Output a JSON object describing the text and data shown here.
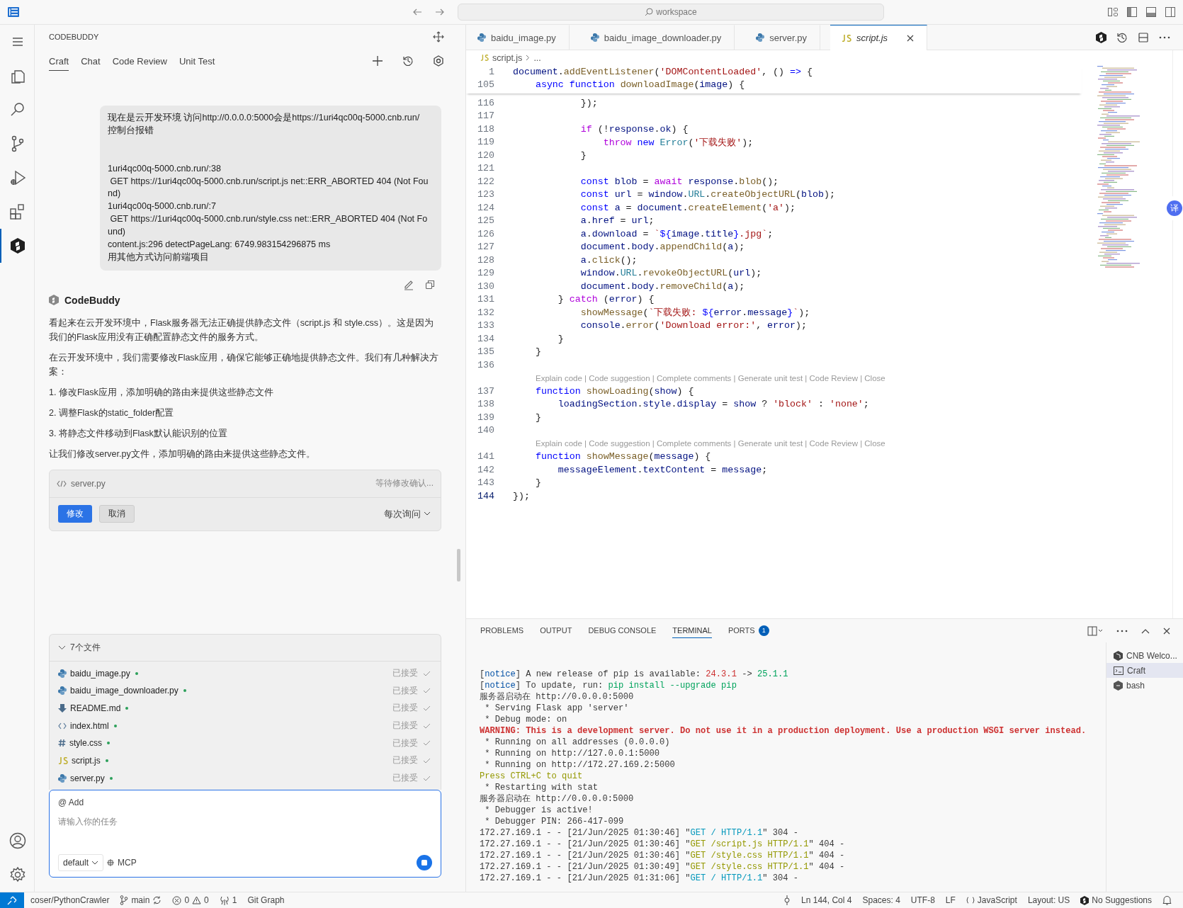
{
  "title_bar": {
    "search": "workspace"
  },
  "activity_bar": {
    "items": [
      {
        "selected": false
      },
      {
        "selected": false
      },
      {
        "selected": false
      },
      {
        "selected": false
      },
      {
        "selected": false
      },
      {
        "selected": true
      }
    ]
  },
  "chat_panel": {
    "title": "CODEBUDDY",
    "tabs": [
      {
        "label": "Craft",
        "selected": true
      },
      {
        "label": "Chat",
        "selected": false
      },
      {
        "label": "Code Review",
        "selected": false
      },
      {
        "label": "Unit Test",
        "selected": false
      }
    ],
    "user_message": [
      [
        "现在是云开发环境 访问http://0.0.0.0:5000会是https://1uri4qc00q-5000.cnb.run/",
        "控制台报错"
      ],
      [
        "1uri4qc00q-5000.cnb.run/:38",
        " GET https://1uri4qc00q-5000.cnb.run/script.js net::ERR_ABORTED 404 (Not Fou",
        "nd)",
        "1uri4qc00q-5000.cnb.run/:7",
        " GET https://1uri4qc00q-5000.cnb.run/style.css net::ERR_ABORTED 404 (Not Fo",
        "und)",
        "content.js:296 detectPageLang: 6749.983154296875 ms",
        "用其他方式访问前端项目"
      ]
    ],
    "assistant": {
      "name": "CodeBuddy",
      "paragraphs": [
        "看起来在云开发环境中，Flask服务器无法正确提供静态文件（script.js 和 style.css）。这是因为我们的Flask应用没有正确配置静态文件的服务方式。",
        "在云开发环境中，我们需要修改Flask应用，确保它能够正确地提供静态文件。我们有几种解决方案：",
        "1. 修改Flask应用，添加明确的路由来提供这些静态文件",
        "2. 调整Flask的static_folder配置",
        "3. 将静态文件移动到Flask默认能识别的位置",
        "让我们修改server.py文件，添加明确的路由来提供这些静态文件。"
      ]
    },
    "file_change": {
      "file": "server.py",
      "status": "等待修改确认...",
      "confirm": "修改",
      "cancel": "取消",
      "mode": "每次询问"
    },
    "files": {
      "summary": "7个文件",
      "expanded": true,
      "items": [
        {
          "name": "baidu_image.py",
          "kind": "python",
          "modified": true,
          "status": "已接受"
        },
        {
          "name": "baidu_image_downloader.py",
          "kind": "python",
          "modified": true,
          "status": "已接受"
        },
        {
          "name": "README.md",
          "kind": "markdown",
          "modified": true,
          "status": "已接受"
        },
        {
          "name": "index.html",
          "kind": "html",
          "modified": true,
          "status": "已接受"
        },
        {
          "name": "style.css",
          "kind": "css",
          "modified": true,
          "status": "已接受"
        },
        {
          "name": "script.js",
          "kind": "js",
          "modified": true,
          "status": "已接受"
        },
        {
          "name": "server.py",
          "kind": "python",
          "modified": true,
          "status": "已接受"
        }
      ]
    },
    "input": {
      "add": "@ Add",
      "placeholder": "请输入你的任务",
      "model": "default",
      "mcp": "MCP"
    }
  },
  "editor": {
    "tabs": [
      {
        "label": "baidu_image.py",
        "kind": "python",
        "selected": false,
        "preview": false
      },
      {
        "label": "baidu_image_downloader.py",
        "kind": "python",
        "selected": false,
        "preview": false
      },
      {
        "label": "server.py",
        "kind": "python",
        "selected": false,
        "preview": false
      },
      {
        "label": "script.js",
        "kind": "js",
        "selected": true,
        "preview": true
      }
    ],
    "breadcrumb": {
      "file": "script.js",
      "rest": "..."
    },
    "sticky": [
      {
        "n": "1",
        "tokens": [
          {
            "kind": "var",
            "text": "document"
          },
          {
            "kind": "plain",
            "text": "."
          },
          {
            "kind": "fn",
            "text": "addEventListener"
          },
          {
            "kind": "plain",
            "text": "("
          },
          {
            "kind": "str",
            "text": "'DOMContentLoaded'"
          },
          {
            "kind": "plain",
            "text": ", () "
          },
          {
            "kind": "kw",
            "text": "=>"
          },
          {
            "kind": "plain",
            "text": " {"
          }
        ]
      },
      {
        "n": "105",
        "tokens": [
          {
            "kind": "kw",
            "text": "    async"
          },
          {
            "kind": "kw",
            "text": " function"
          },
          {
            "kind": "fn",
            "text": " downloadImage"
          },
          {
            "kind": "plain",
            "text": "("
          },
          {
            "kind": "var",
            "text": "image"
          },
          {
            "kind": "plain",
            "text": ") {"
          }
        ]
      }
    ],
    "lines": [
      {
        "kind": "code",
        "n": "116",
        "tokens": [
          {
            "kind": "plain",
            "text": "            });"
          }
        ]
      },
      {
        "kind": "code",
        "n": "117"
      },
      {
        "kind": "code",
        "n": "118",
        "tokens": [
          {
            "kind": "ctl",
            "text": "            if"
          },
          {
            "kind": "plain",
            "text": " (!"
          },
          {
            "kind": "var",
            "text": "response"
          },
          {
            "kind": "plain",
            "text": "."
          },
          {
            "kind": "var",
            "text": "ok"
          },
          {
            "kind": "plain",
            "text": ") {"
          }
        ]
      },
      {
        "kind": "code",
        "n": "119",
        "tokens": [
          {
            "kind": "ctl",
            "text": "                throw"
          },
          {
            "kind": "kw",
            "text": " new"
          },
          {
            "kind": "type",
            "text": " Error"
          },
          {
            "kind": "plain",
            "text": "("
          },
          {
            "kind": "str",
            "text": "'下载失败'"
          },
          {
            "kind": "plain",
            "text": ");"
          }
        ]
      },
      {
        "kind": "code",
        "n": "120",
        "tokens": [
          {
            "kind": "plain",
            "text": "            }"
          }
        ]
      },
      {
        "kind": "code",
        "n": "121"
      },
      {
        "kind": "code",
        "n": "122",
        "tokens": [
          {
            "kind": "kw",
            "text": "            const"
          },
          {
            "kind": "var",
            "text": " blob"
          },
          {
            "kind": "plain",
            "text": " = "
          },
          {
            "kind": "ctl",
            "text": "await"
          },
          {
            "kind": "var",
            "text": " response"
          },
          {
            "kind": "plain",
            "text": "."
          },
          {
            "kind": "fn",
            "text": "blob"
          },
          {
            "kind": "plain",
            "text": "();"
          }
        ]
      },
      {
        "kind": "code",
        "n": "123",
        "tokens": [
          {
            "kind": "kw",
            "text": "            const"
          },
          {
            "kind": "var",
            "text": " url"
          },
          {
            "kind": "plain",
            "text": " = "
          },
          {
            "kind": "var",
            "text": "window"
          },
          {
            "kind": "plain",
            "text": "."
          },
          {
            "kind": "type",
            "text": "URL"
          },
          {
            "kind": "plain",
            "text": "."
          },
          {
            "kind": "fn",
            "text": "createObjectURL"
          },
          {
            "kind": "plain",
            "text": "("
          },
          {
            "kind": "var",
            "text": "blob"
          },
          {
            "kind": "plain",
            "text": ");"
          }
        ]
      },
      {
        "kind": "code",
        "n": "124",
        "tokens": [
          {
            "kind": "kw",
            "text": "            const"
          },
          {
            "kind": "var",
            "text": " a"
          },
          {
            "kind": "plain",
            "text": " = "
          },
          {
            "kind": "var",
            "text": "document"
          },
          {
            "kind": "plain",
            "text": "."
          },
          {
            "kind": "fn",
            "text": "createElement"
          },
          {
            "kind": "plain",
            "text": "("
          },
          {
            "kind": "str",
            "text": "'a'"
          },
          {
            "kind": "plain",
            "text": ");"
          }
        ]
      },
      {
        "kind": "code",
        "n": "125",
        "tokens": [
          {
            "kind": "var",
            "text": "            a"
          },
          {
            "kind": "plain",
            "text": "."
          },
          {
            "kind": "var",
            "text": "href"
          },
          {
            "kind": "plain",
            "text": " = "
          },
          {
            "kind": "var",
            "text": "url"
          },
          {
            "kind": "plain",
            "text": ";"
          }
        ]
      },
      {
        "kind": "code",
        "n": "126",
        "tokens": [
          {
            "kind": "var",
            "text": "            a"
          },
          {
            "kind": "plain",
            "text": "."
          },
          {
            "kind": "var",
            "text": "download"
          },
          {
            "kind": "plain",
            "text": " = "
          },
          {
            "kind": "str",
            "text": "`"
          },
          {
            "kind": "kw",
            "text": "${"
          },
          {
            "kind": "var",
            "text": "image"
          },
          {
            "kind": "plain",
            "text": "."
          },
          {
            "kind": "var",
            "text": "title"
          },
          {
            "kind": "kw",
            "text": "}"
          },
          {
            "kind": "str",
            "text": ".jpg`"
          },
          {
            "kind": "plain",
            "text": ";"
          }
        ]
      },
      {
        "kind": "code",
        "n": "127",
        "tokens": [
          {
            "kind": "var",
            "text": "            document"
          },
          {
            "kind": "plain",
            "text": "."
          },
          {
            "kind": "var",
            "text": "body"
          },
          {
            "kind": "plain",
            "text": "."
          },
          {
            "kind": "fn",
            "text": "appendChild"
          },
          {
            "kind": "plain",
            "text": "("
          },
          {
            "kind": "var",
            "text": "a"
          },
          {
            "kind": "plain",
            "text": ");"
          }
        ]
      },
      {
        "kind": "code",
        "n": "128",
        "tokens": [
          {
            "kind": "var",
            "text": "            a"
          },
          {
            "kind": "plain",
            "text": "."
          },
          {
            "kind": "fn",
            "text": "click"
          },
          {
            "kind": "plain",
            "text": "();"
          }
        ]
      },
      {
        "kind": "code",
        "n": "129",
        "tokens": [
          {
            "kind": "var",
            "text": "            window"
          },
          {
            "kind": "plain",
            "text": "."
          },
          {
            "kind": "type",
            "text": "URL"
          },
          {
            "kind": "plain",
            "text": "."
          },
          {
            "kind": "fn",
            "text": "revokeObjectURL"
          },
          {
            "kind": "plain",
            "text": "("
          },
          {
            "kind": "var",
            "text": "url"
          },
          {
            "kind": "plain",
            "text": ");"
          }
        ]
      },
      {
        "kind": "code",
        "n": "130",
        "tokens": [
          {
            "kind": "var",
            "text": "            document"
          },
          {
            "kind": "plain",
            "text": "."
          },
          {
            "kind": "var",
            "text": "body"
          },
          {
            "kind": "plain",
            "text": "."
          },
          {
            "kind": "fn",
            "text": "removeChild"
          },
          {
            "kind": "plain",
            "text": "("
          },
          {
            "kind": "var",
            "text": "a"
          },
          {
            "kind": "plain",
            "text": ");"
          }
        ]
      },
      {
        "kind": "code",
        "n": "131",
        "tokens": [
          {
            "kind": "plain",
            "text": "        } "
          },
          {
            "kind": "ctl",
            "text": "catch"
          },
          {
            "kind": "plain",
            "text": " ("
          },
          {
            "kind": "var",
            "text": "error"
          },
          {
            "kind": "plain",
            "text": ") {"
          }
        ]
      },
      {
        "kind": "code",
        "n": "132",
        "tokens": [
          {
            "kind": "fn",
            "text": "            showMessage"
          },
          {
            "kind": "plain",
            "text": "("
          },
          {
            "kind": "str",
            "text": "`下载失败: "
          },
          {
            "kind": "kw",
            "text": "${"
          },
          {
            "kind": "var",
            "text": "error"
          },
          {
            "kind": "plain",
            "text": "."
          },
          {
            "kind": "var",
            "text": "message"
          },
          {
            "kind": "kw",
            "text": "}"
          },
          {
            "kind": "str",
            "text": "`"
          },
          {
            "kind": "plain",
            "text": ");"
          }
        ]
      },
      {
        "kind": "code",
        "n": "133",
        "tokens": [
          {
            "kind": "var",
            "text": "            console"
          },
          {
            "kind": "plain",
            "text": "."
          },
          {
            "kind": "fn",
            "text": "error"
          },
          {
            "kind": "plain",
            "text": "("
          },
          {
            "kind": "str",
            "text": "'Download error:'"
          },
          {
            "kind": "plain",
            "text": ", "
          },
          {
            "kind": "var",
            "text": "error"
          },
          {
            "kind": "plain",
            "text": ");"
          }
        ]
      },
      {
        "kind": "code",
        "n": "134",
        "tokens": [
          {
            "kind": "plain",
            "text": "        }"
          }
        ]
      },
      {
        "kind": "code",
        "n": "135",
        "tokens": [
          {
            "kind": "plain",
            "text": "    }"
          }
        ]
      },
      {
        "kind": "code",
        "n": "136"
      },
      {
        "kind": "lens",
        "text": "Explain code | Code suggestion | Complete comments | Generate unit test | Code Review | Close"
      },
      {
        "kind": "code",
        "n": "137",
        "tokens": [
          {
            "kind": "kw",
            "text": "    function"
          },
          {
            "kind": "fn",
            "text": " showLoading"
          },
          {
            "kind": "plain",
            "text": "("
          },
          {
            "kind": "var",
            "text": "show"
          },
          {
            "kind": "plain",
            "text": ") {"
          }
        ]
      },
      {
        "kind": "code",
        "n": "138",
        "tokens": [
          {
            "kind": "var",
            "text": "        loadingSection"
          },
          {
            "kind": "plain",
            "text": "."
          },
          {
            "kind": "var",
            "text": "style"
          },
          {
            "kind": "plain",
            "text": "."
          },
          {
            "kind": "var",
            "text": "display"
          },
          {
            "kind": "plain",
            "text": " = "
          },
          {
            "kind": "var",
            "text": "show"
          },
          {
            "kind": "plain",
            "text": " ? "
          },
          {
            "kind": "str",
            "text": "'block'"
          },
          {
            "kind": "plain",
            "text": " : "
          },
          {
            "kind": "str",
            "text": "'none'"
          },
          {
            "kind": "plain",
            "text": ";"
          }
        ]
      },
      {
        "kind": "code",
        "n": "139",
        "tokens": [
          {
            "kind": "plain",
            "text": "    }"
          }
        ]
      },
      {
        "kind": "code",
        "n": "140"
      },
      {
        "kind": "lens",
        "text": "Explain code | Code suggestion | Complete comments | Generate unit test | Code Review | Close"
      },
      {
        "kind": "code",
        "n": "141",
        "tokens": [
          {
            "kind": "kw",
            "text": "    function"
          },
          {
            "kind": "fn",
            "text": " showMessage"
          },
          {
            "kind": "plain",
            "text": "("
          },
          {
            "kind": "var",
            "text": "message"
          },
          {
            "kind": "plain",
            "text": ") {"
          }
        ]
      },
      {
        "kind": "code",
        "n": "142",
        "tokens": [
          {
            "kind": "var",
            "text": "        messageElement"
          },
          {
            "kind": "plain",
            "text": "."
          },
          {
            "kind": "var",
            "text": "textContent"
          },
          {
            "kind": "plain",
            "text": " = "
          },
          {
            "kind": "var",
            "text": "message"
          },
          {
            "kind": "plain",
            "text": ";"
          }
        ]
      },
      {
        "kind": "code",
        "n": "143",
        "tokens": [
          {
            "kind": "plain",
            "text": "    }"
          }
        ]
      },
      {
        "kind": "code",
        "n": "144",
        "tokens": [
          {
            "kind": "plain",
            "text": "});"
          }
        ]
      }
    ],
    "translate_badge": "译"
  },
  "panel": {
    "tabs": [
      {
        "label": "PROBLEMS",
        "selected": false
      },
      {
        "label": "OUTPUT",
        "selected": false
      },
      {
        "label": "DEBUG CONSOLE",
        "selected": false
      },
      {
        "label": "TERMINAL",
        "selected": true
      },
      {
        "label": "PORTS",
        "selected": false,
        "badge": "1"
      }
    ],
    "terminal": [
      [
        {
          "kind": "plain",
          "text": "["
        },
        {
          "kind": "notice",
          "text": "notice"
        },
        {
          "kind": "plain",
          "text": "] A new release of pip is available: "
        },
        {
          "kind": "old",
          "text": "24.3.1"
        },
        {
          "kind": "plain",
          "text": " -> "
        },
        {
          "kind": "new",
          "text": "25.1.1"
        }
      ],
      [
        {
          "kind": "plain",
          "text": "["
        },
        {
          "kind": "notice",
          "text": "notice"
        },
        {
          "kind": "plain",
          "text": "] To update, run: "
        },
        {
          "kind": "new",
          "text": "pip install --upgrade pip"
        }
      ],
      [
        {
          "kind": "plain",
          "text": "服务器启动在 http://0.0.0.0:5000"
        }
      ],
      [
        {
          "kind": "plain",
          "text": " * Serving Flask app 'server'"
        }
      ],
      [
        {
          "kind": "plain",
          "text": " * Debug mode: on"
        }
      ],
      [
        {
          "kind": "warning",
          "text": "WARNING: This is a development server. Do not use it in a production deployment. Use a production WSGI server instead."
        }
      ],
      [
        {
          "kind": "plain",
          "text": " * Running on all addresses (0.0.0.0)"
        }
      ],
      [
        {
          "kind": "plain",
          "text": " * Running on http://127.0.0.1:5000"
        }
      ],
      [
        {
          "kind": "plain",
          "text": " * Running on http://172.27.169.2:5000"
        }
      ],
      [
        {
          "kind": "hint",
          "text": "Press CTRL+C to quit"
        }
      ],
      [
        {
          "kind": "plain",
          "text": " * Restarting with stat"
        }
      ],
      [
        {
          "kind": "plain",
          "text": "服务器启动在 http://0.0.0.0:5000"
        }
      ],
      [
        {
          "kind": "plain",
          "text": " * Debugger is active!"
        }
      ],
      [
        {
          "kind": "plain",
          "text": " * Debugger PIN: 266-417-099"
        }
      ],
      [
        {
          "kind": "plain",
          "text": "172.27.169.1 - - [21/Jun/2025 01:30:46] \""
        },
        {
          "kind": "ok",
          "text": "GET / HTTP/1.1"
        },
        {
          "kind": "plain",
          "text": "\" 304 -"
        }
      ],
      [
        {
          "kind": "plain",
          "text": "172.27.169.1 - - [21/Jun/2025 01:30:46] \""
        },
        {
          "kind": "hint",
          "text": "GET /script.js HTTP/1.1"
        },
        {
          "kind": "plain",
          "text": "\" 404 -"
        }
      ],
      [
        {
          "kind": "plain",
          "text": "172.27.169.1 - - [21/Jun/2025 01:30:46] \""
        },
        {
          "kind": "hint",
          "text": "GET /style.css HTTP/1.1"
        },
        {
          "kind": "plain",
          "text": "\" 404 -"
        }
      ],
      [
        {
          "kind": "plain",
          "text": "172.27.169.1 - - [21/Jun/2025 01:30:49] \""
        },
        {
          "kind": "hint",
          "text": "GET /style.css HTTP/1.1"
        },
        {
          "kind": "plain",
          "text": "\" 404 -"
        }
      ],
      [
        {
          "kind": "plain",
          "text": "172.27.169.1 - - [21/Jun/2025 01:31:06] \""
        },
        {
          "kind": "ok",
          "text": "GET / HTTP/1.1"
        },
        {
          "kind": "plain",
          "text": "\" 304 -"
        }
      ]
    ],
    "terminals": [
      {
        "label": "CNB Welco...",
        "kind": "cnb",
        "selected": false
      },
      {
        "label": "Craft",
        "kind": "terminal",
        "selected": true
      },
      {
        "label": "bash",
        "kind": "bash",
        "selected": false
      }
    ]
  },
  "status_bar": {
    "repo": "coser/PythonCrawler",
    "branch": "main",
    "errors": "0",
    "warnings": "0",
    "ports": "1",
    "git_graph": "Git Graph",
    "right": [
      "Ln 144, Col 4",
      "Spaces: 4",
      "UTF-8",
      "LF",
      "JavaScript",
      "Layout: US",
      "No Suggestions"
    ]
  }
}
